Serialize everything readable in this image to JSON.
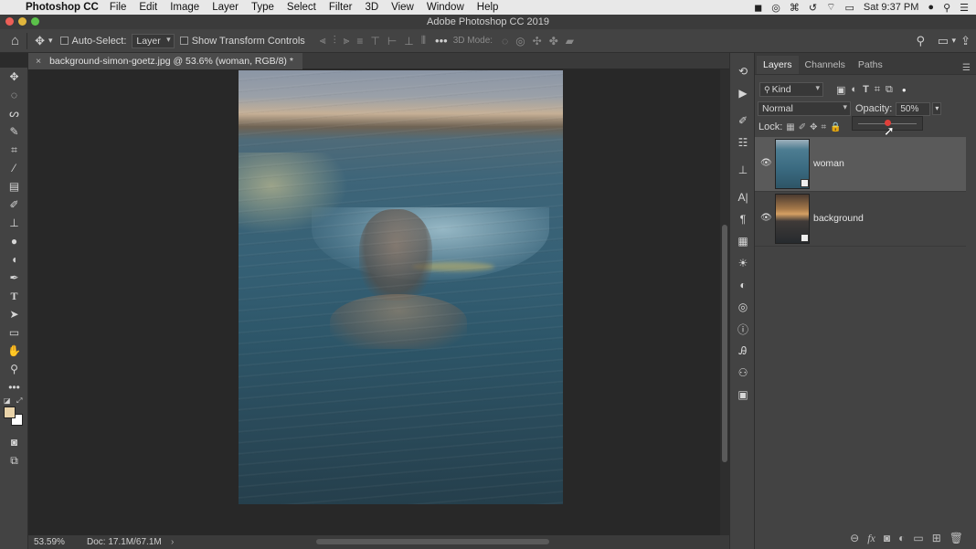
{
  "menubar": {
    "app_name": "Photoshop CC",
    "items": [
      "File",
      "Edit",
      "Image",
      "Layer",
      "Type",
      "Select",
      "Filter",
      "3D",
      "View",
      "Window",
      "Help"
    ],
    "clock": "Sat 9:37 PM"
  },
  "window": {
    "title": "Adobe Photoshop CC 2019"
  },
  "options": {
    "auto_select_label": "Auto-Select:",
    "auto_select_target": "Layer",
    "transform_label": "Show Transform Controls",
    "mode_3d_label": "3D Mode:"
  },
  "document": {
    "tab_title": "background-simon-goetz.jpg @ 53.6% (woman, RGB/8) *"
  },
  "status": {
    "zoom": "53.59%",
    "doc_size": "Doc: 17.1M/67.1M"
  },
  "layers_panel": {
    "tabs": [
      "Layers",
      "Channels",
      "Paths"
    ],
    "filter_kind": "Kind",
    "blend_mode": "Normal",
    "opacity_label": "Opacity:",
    "opacity_value": "50%",
    "opacity_fraction": 0.5,
    "lock_label": "Lock:",
    "layers": [
      {
        "name": "woman",
        "selected": true,
        "visible": true
      },
      {
        "name": "background",
        "selected": false,
        "visible": true
      }
    ]
  },
  "colors": {
    "accent_red": "#e0403a",
    "panel_bg": "#434343",
    "selected_layer_bg": "#5a5a5a",
    "menubar_bg": "#e8e8e8"
  },
  "icons": {
    "tools": [
      "move-icon",
      "marquee-icon",
      "lasso-icon",
      "quick-select-icon",
      "crop-icon",
      "eyedropper-icon",
      "healing-icon",
      "brush-icon",
      "stamp-icon",
      "blur-icon",
      "smudge-icon",
      "pen-icon",
      "type-icon",
      "path-select-icon",
      "rectangle-icon",
      "hand-icon",
      "zoom-icon",
      "more-tools-icon"
    ]
  }
}
